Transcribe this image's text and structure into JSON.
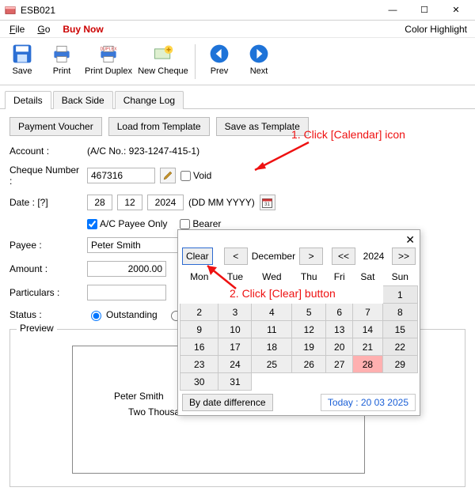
{
  "window": {
    "title": "ESB021"
  },
  "menu": {
    "file": "File",
    "go": "Go",
    "buy": "Buy Now",
    "highlight": "Color Highlight"
  },
  "toolbar": {
    "save": "Save",
    "print": "Print",
    "duplex": "Print Duplex",
    "newcheque": "New Cheque",
    "prev": "Prev",
    "next": "Next"
  },
  "tabs": {
    "details": "Details",
    "backside": "Back Side",
    "changelog": "Change Log"
  },
  "buttons": {
    "voucher": "Payment Voucher",
    "load": "Load from Template",
    "saveas": "Save as Template"
  },
  "labels": {
    "account": "Account :",
    "cheque": "Cheque Number :",
    "date": "Date : [?]",
    "dateformat": "(DD MM YYYY)",
    "void": "Void",
    "acpayee": "A/C Payee Only",
    "bearer": "Bearer",
    "payee": "Payee :",
    "amount": "Amount :",
    "particulars": "Particulars :",
    "status": "Status :",
    "outstanding": "Outstanding",
    "clear": "Clear",
    "preview": "Preview"
  },
  "values": {
    "account_text": "(A/C No.: 923-1247-415-1)",
    "cheque": "467316",
    "dd": "28",
    "mm": "12",
    "yyyy": "2024",
    "payee": "Peter Smith",
    "amount": "2000.00",
    "preview_payee": "Peter Smith",
    "preview_words": "Two Thousand D"
  },
  "anno": {
    "a1": "1. Click [Calendar] icon",
    "a2": "2. Click [Clear] button"
  },
  "cal": {
    "clear": "Clear",
    "prev": "<",
    "next": ">",
    "prev2": "<<",
    "next2": ">>",
    "month": "December",
    "year": "2024",
    "dow": [
      "Mon",
      "Tue",
      "Wed",
      "Thu",
      "Fri",
      "Sat",
      "Sun"
    ],
    "grid": [
      [
        "",
        "",
        "",
        "",
        "",
        "",
        "1"
      ],
      [
        "2",
        "3",
        "4",
        "5",
        "6",
        "7",
        "8"
      ],
      [
        "9",
        "10",
        "11",
        "12",
        "13",
        "14",
        "15"
      ],
      [
        "16",
        "17",
        "18",
        "19",
        "20",
        "21",
        "22"
      ],
      [
        "23",
        "24",
        "25",
        "26",
        "27",
        "28",
        "29"
      ],
      [
        "30",
        "31",
        "",
        "",
        "",
        "",
        ""
      ]
    ],
    "highlight": "28",
    "bydiff": "By date difference",
    "today": "Today : 20 03 2025"
  }
}
